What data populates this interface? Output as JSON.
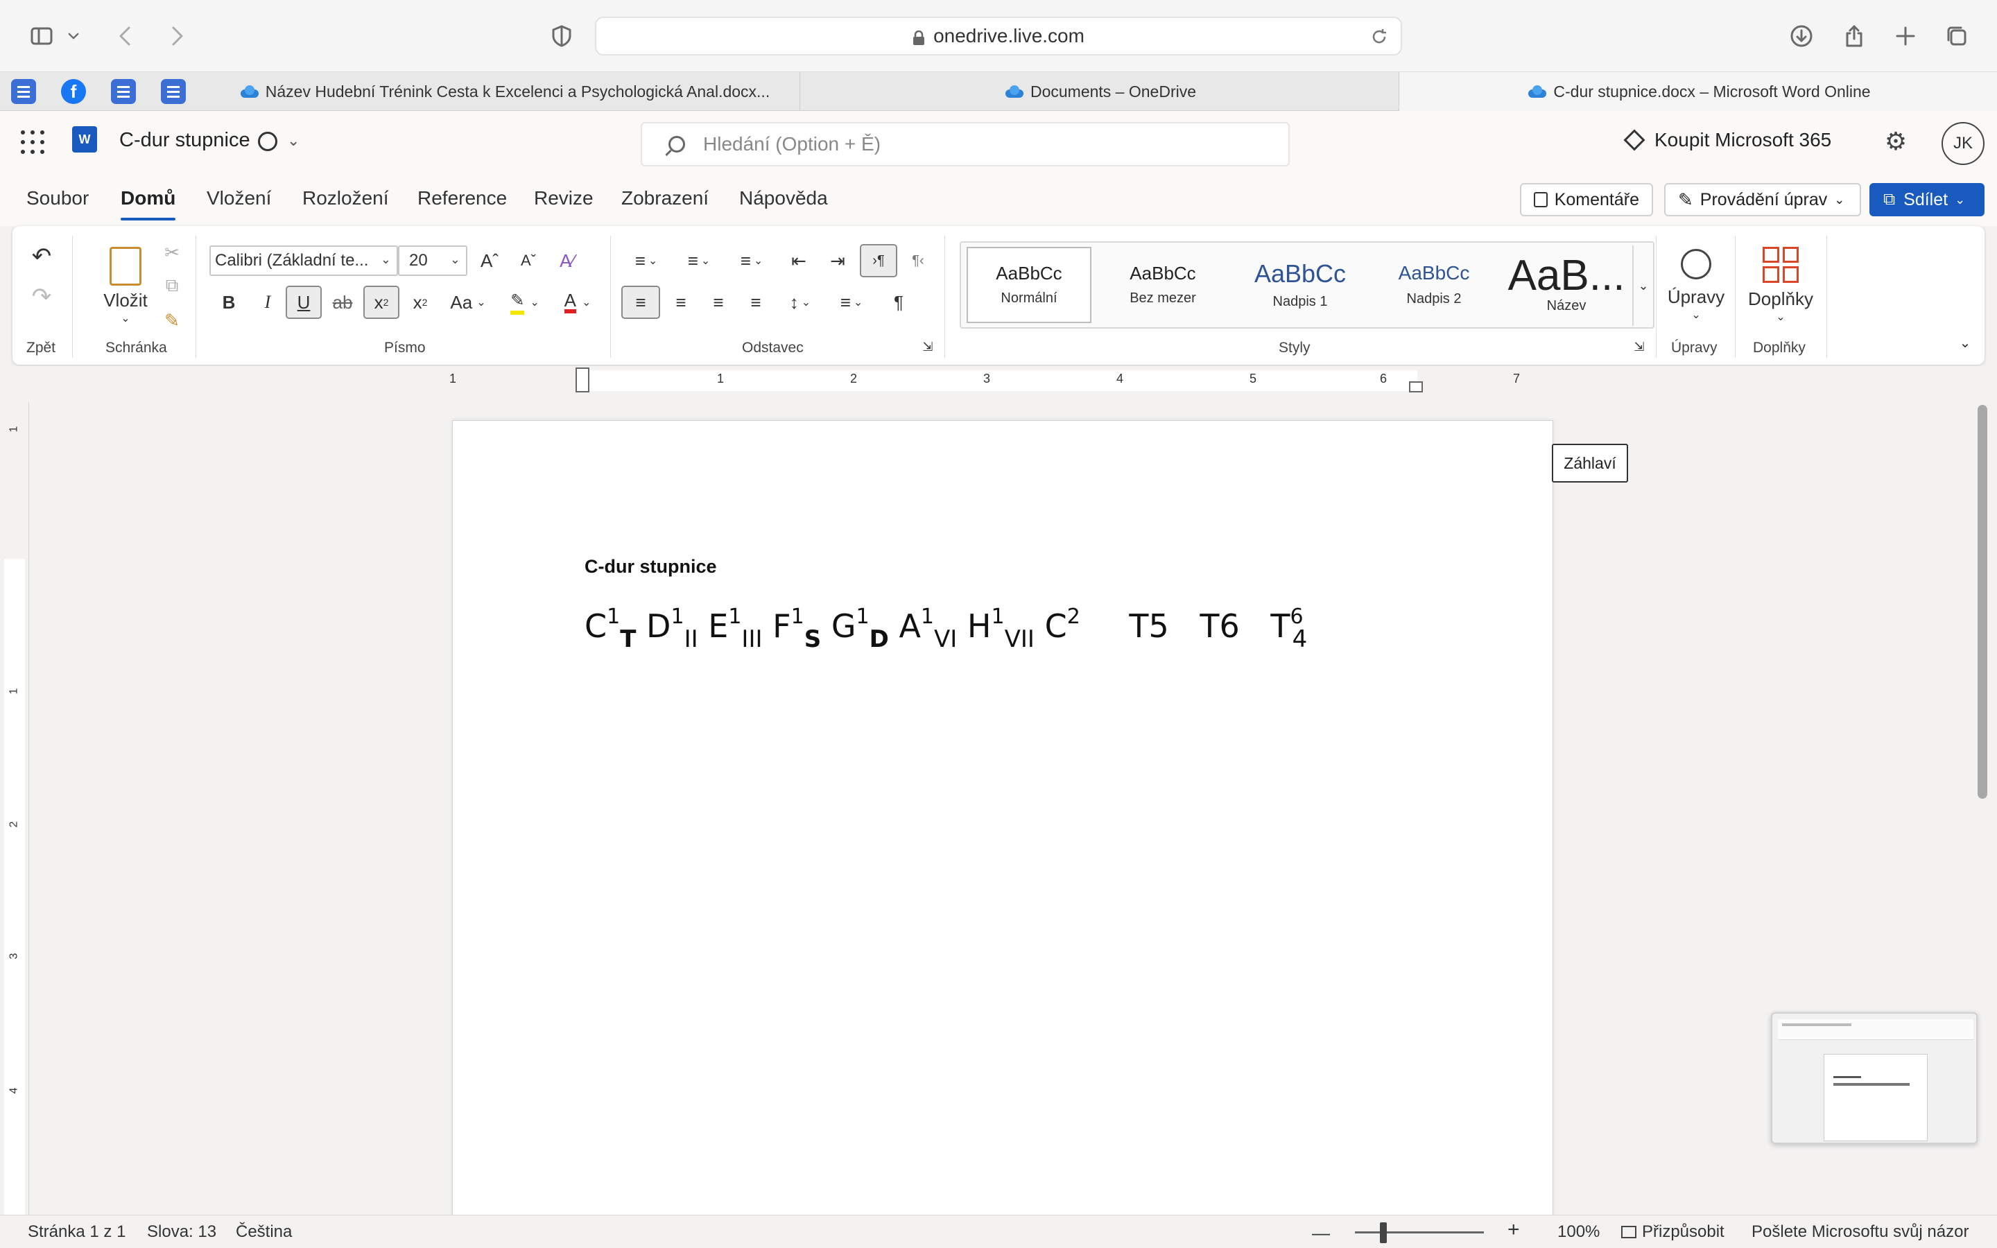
{
  "browser": {
    "url": "onedrive.live.com"
  },
  "tabs": [
    {
      "label": "Název Hudební Trénink Cesta k Excelenci a Psychologická Anal.docx..."
    },
    {
      "label": "Documents – OneDrive"
    },
    {
      "label": "C-dur stupnice.docx – Microsoft Word Online"
    }
  ],
  "app": {
    "logo": "W",
    "doc_title": "C-dur stupnice",
    "search_placeholder": "Hledání (Option + Ě)",
    "buy_label": "Koupit Microsoft 365",
    "avatar": "JK"
  },
  "menu": {
    "tabs": [
      "Soubor",
      "Domů",
      "Vložení",
      "Rozložení",
      "Reference",
      "Revize",
      "Zobrazení",
      "Nápověda"
    ],
    "comments_label": "Komentáře",
    "editing_label": "Provádění úprav",
    "share_label": "Sdílet"
  },
  "ribbon": {
    "undo_group": "Zpět",
    "paste_label": "Vložit",
    "clipboard_group": "Schránka",
    "font_name": "Calibri (Základní te...",
    "font_size": "20",
    "font_group": "Písmo",
    "paragraph_group": "Odstavec",
    "styles_group": "Styly",
    "styles": [
      {
        "preview": "AaBbCc",
        "name": "Normální"
      },
      {
        "preview": "AaBbCc",
        "name": "Bez mezer"
      },
      {
        "preview": "AaBbCc",
        "name": "Nadpis 1"
      },
      {
        "preview": "AaBbCc",
        "name": "Nadpis 2"
      },
      {
        "preview": "AaB...",
        "name": "Název"
      }
    ],
    "editing_button": "Úpravy",
    "editing_group": "Úpravy",
    "addins_button": "Doplňky",
    "addins_group": "Doplňky",
    "btn_bold": "B",
    "btn_italic": "I",
    "btn_underline": "U",
    "btn_strike": "ab",
    "btn_change_case": "Aa"
  },
  "ruler": {
    "numbers": [
      "1",
      "1",
      "2",
      "3",
      "4",
      "5",
      "6",
      "7"
    ],
    "vnumbers": [
      "1",
      "1",
      "2",
      "3",
      "4"
    ]
  },
  "document": {
    "header_tag": "Záhlaví",
    "heading": "C-dur stupnice",
    "notes": [
      {
        "main": "C",
        "sup": "1",
        "sub": "T",
        "bold_sub": true
      },
      {
        "main": "D",
        "sup": "1",
        "sub": "II",
        "bold_sub": false
      },
      {
        "main": "E",
        "sup": "1",
        "sub": "III",
        "bold_sub": false
      },
      {
        "main": "F",
        "sup": "1",
        "sub": "S",
        "bold_sub": true
      },
      {
        "main": "G",
        "sup": "1",
        "sub": "D",
        "bold_sub": true
      },
      {
        "main": "A",
        "sup": "1",
        "sub": "VI",
        "bold_sub": false
      },
      {
        "main": "H",
        "sup": "1",
        "sub": "VII",
        "bold_sub": false
      },
      {
        "main": "C",
        "sup": "2",
        "sub": "",
        "bold_sub": false
      }
    ],
    "chords": [
      "T5",
      "T6"
    ],
    "last_chord": {
      "main": "T",
      "sup": "6",
      "sub": "4"
    }
  },
  "status": {
    "page": "Stránka 1 z 1",
    "words": "Slova: 13",
    "language": "Čeština",
    "zoom_minus": "—",
    "zoom_plus": "+",
    "zoom": "100%",
    "fit": "Přizpůsobit",
    "feedback": "Pošlete Microsoftu svůj názor"
  }
}
